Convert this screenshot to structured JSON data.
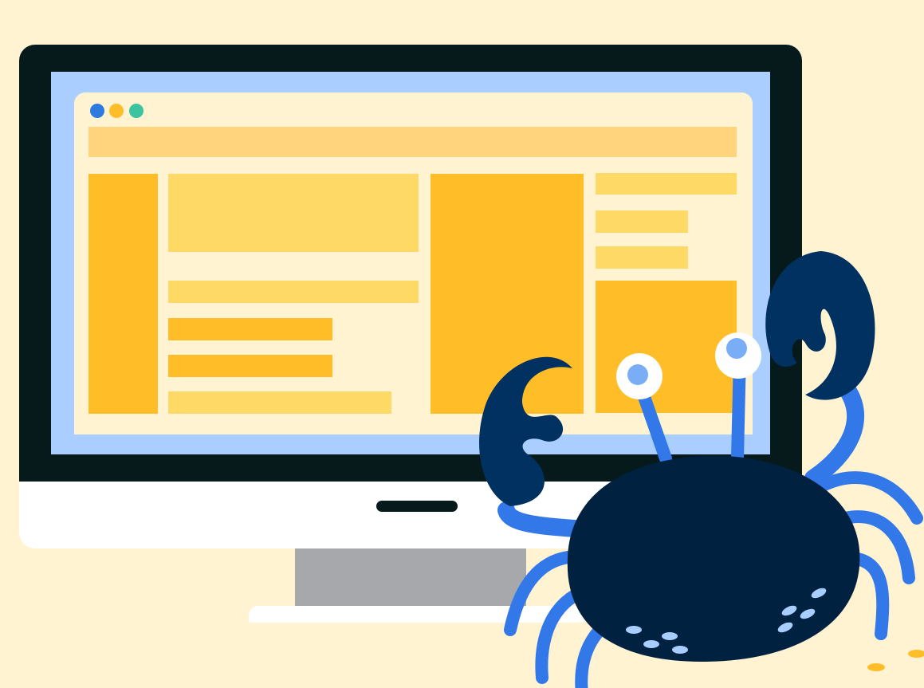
{
  "illustration": {
    "subject": [
      "monitor",
      "browser-wireframe",
      "crab"
    ],
    "colors": {
      "background": "#FFF3D1",
      "bezel": "#061A1C",
      "screen": "#A9CEFF",
      "browser_background": "#FFF3D1",
      "block_light": "#FFD966",
      "block_dark": "#FFBE28",
      "address_bar": "#FFD47D",
      "dot_blue": "#2E7BE0",
      "dot_yellow": "#FFBE28",
      "dot_green": "#3CC4A0",
      "crab_body": "#00213F",
      "crab_claw": "#003161",
      "crab_leg": "#3378E8",
      "crab_eye_pupil": "#79ADF5",
      "crab_spots": "#A8CDFF"
    },
    "icons": {
      "window_dots": [
        "circle",
        "circle",
        "circle"
      ],
      "mascot": "crab-icon"
    }
  }
}
